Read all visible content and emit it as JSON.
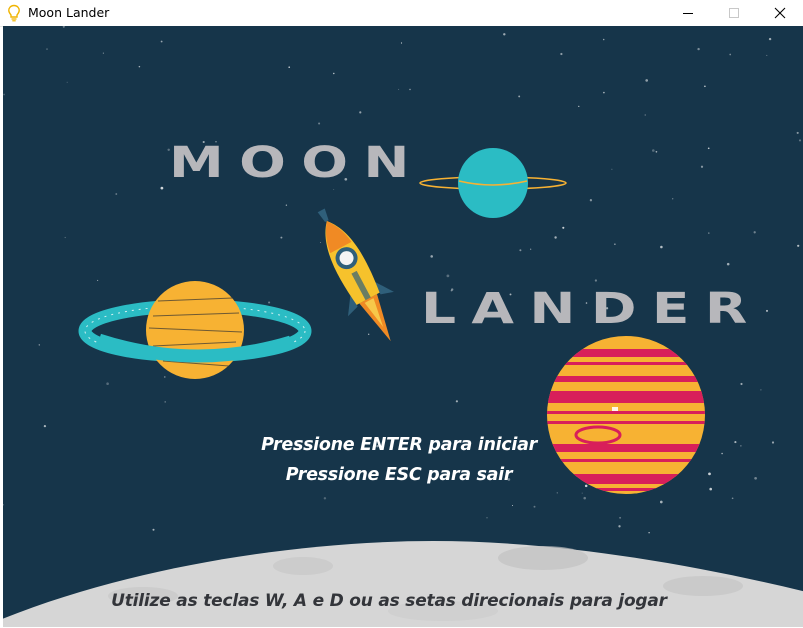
{
  "window": {
    "title": "Moon Lander",
    "icon": "lightbulb-icon",
    "controls": [
      "minimize-icon",
      "maximize-icon",
      "close-icon"
    ]
  },
  "game": {
    "title_word_1": "MOON",
    "title_word_2": "LANDER",
    "prompt_start": "Pressione ENTER para iniciar",
    "prompt_exit": "Pressione ESC para sair",
    "instructions": "Utilize as teclas W, A e D  ou as setas direcionais para jogar"
  },
  "colors": {
    "background": "#16354a",
    "title_text": "#b7b7bb",
    "planet_teal": "#2bbcc4",
    "planet_orange": "#f7b233",
    "planet_red_stripes": "#d81f5a",
    "rocket_yellow": "#f6c22c",
    "moon_surface": "#d9d9d9"
  }
}
